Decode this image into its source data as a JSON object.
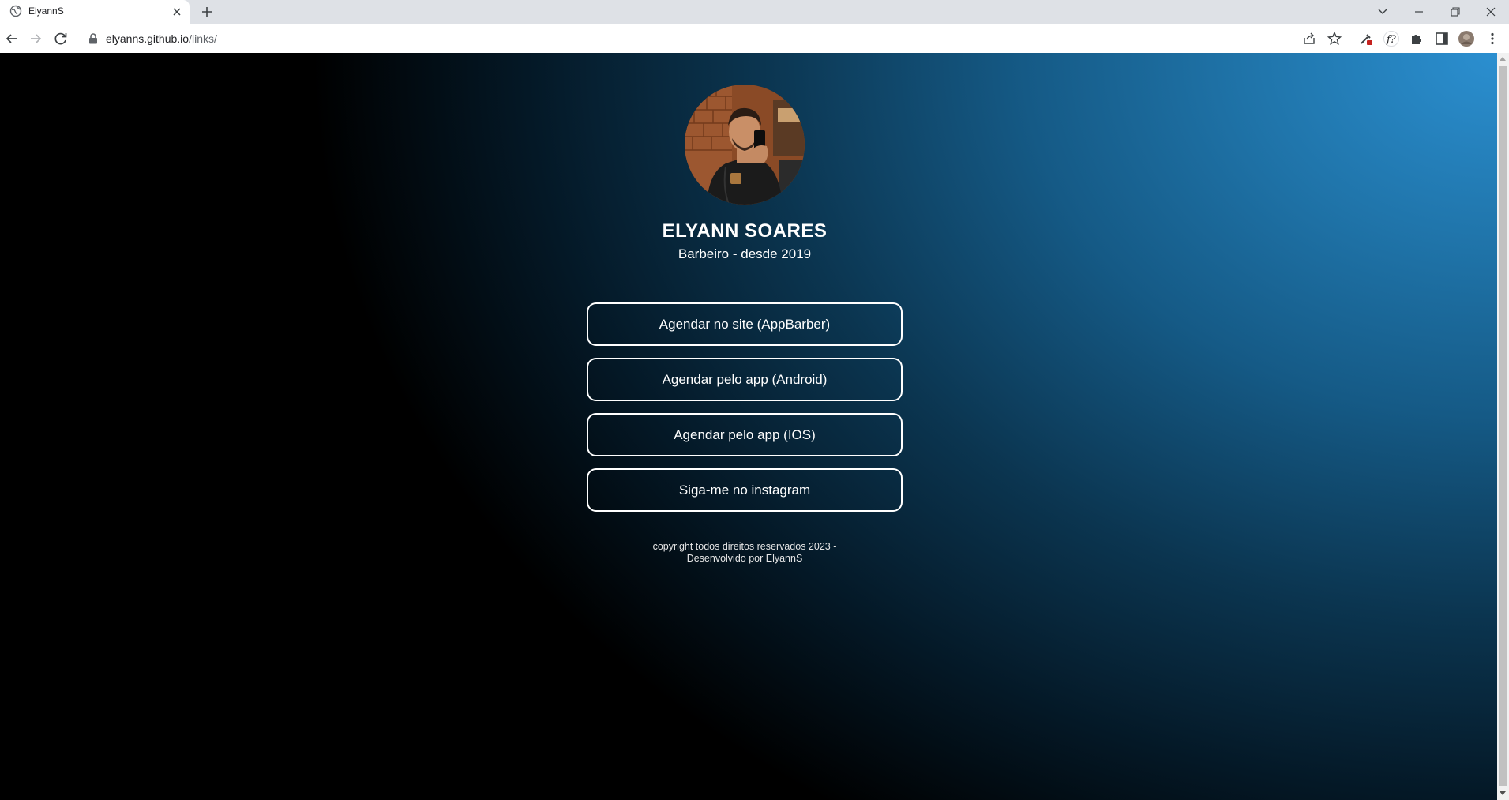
{
  "browser": {
    "tab_title": "ElyannS",
    "url_host": "elyanns.github.io",
    "url_path": "/links/"
  },
  "profile": {
    "name": "ELYANN SOARES",
    "subtitle": "Barbeiro - desde 2019"
  },
  "links": [
    {
      "label": "Agendar no site (AppBarber)"
    },
    {
      "label": "Agendar pelo app (Android)"
    },
    {
      "label": "Agendar pelo app (IOS)"
    },
    {
      "label": "Siga-me no instagram"
    }
  ],
  "footer": {
    "line1": "copyright todos direitos reservados 2023 -",
    "line2": "Desenvolvido por ElyannS"
  },
  "colors": {
    "tabstrip_bg": "#dee1e6",
    "page_gradient_light": "#2b8fd0",
    "page_gradient_dark": "#000000",
    "text": "#ffffff"
  }
}
